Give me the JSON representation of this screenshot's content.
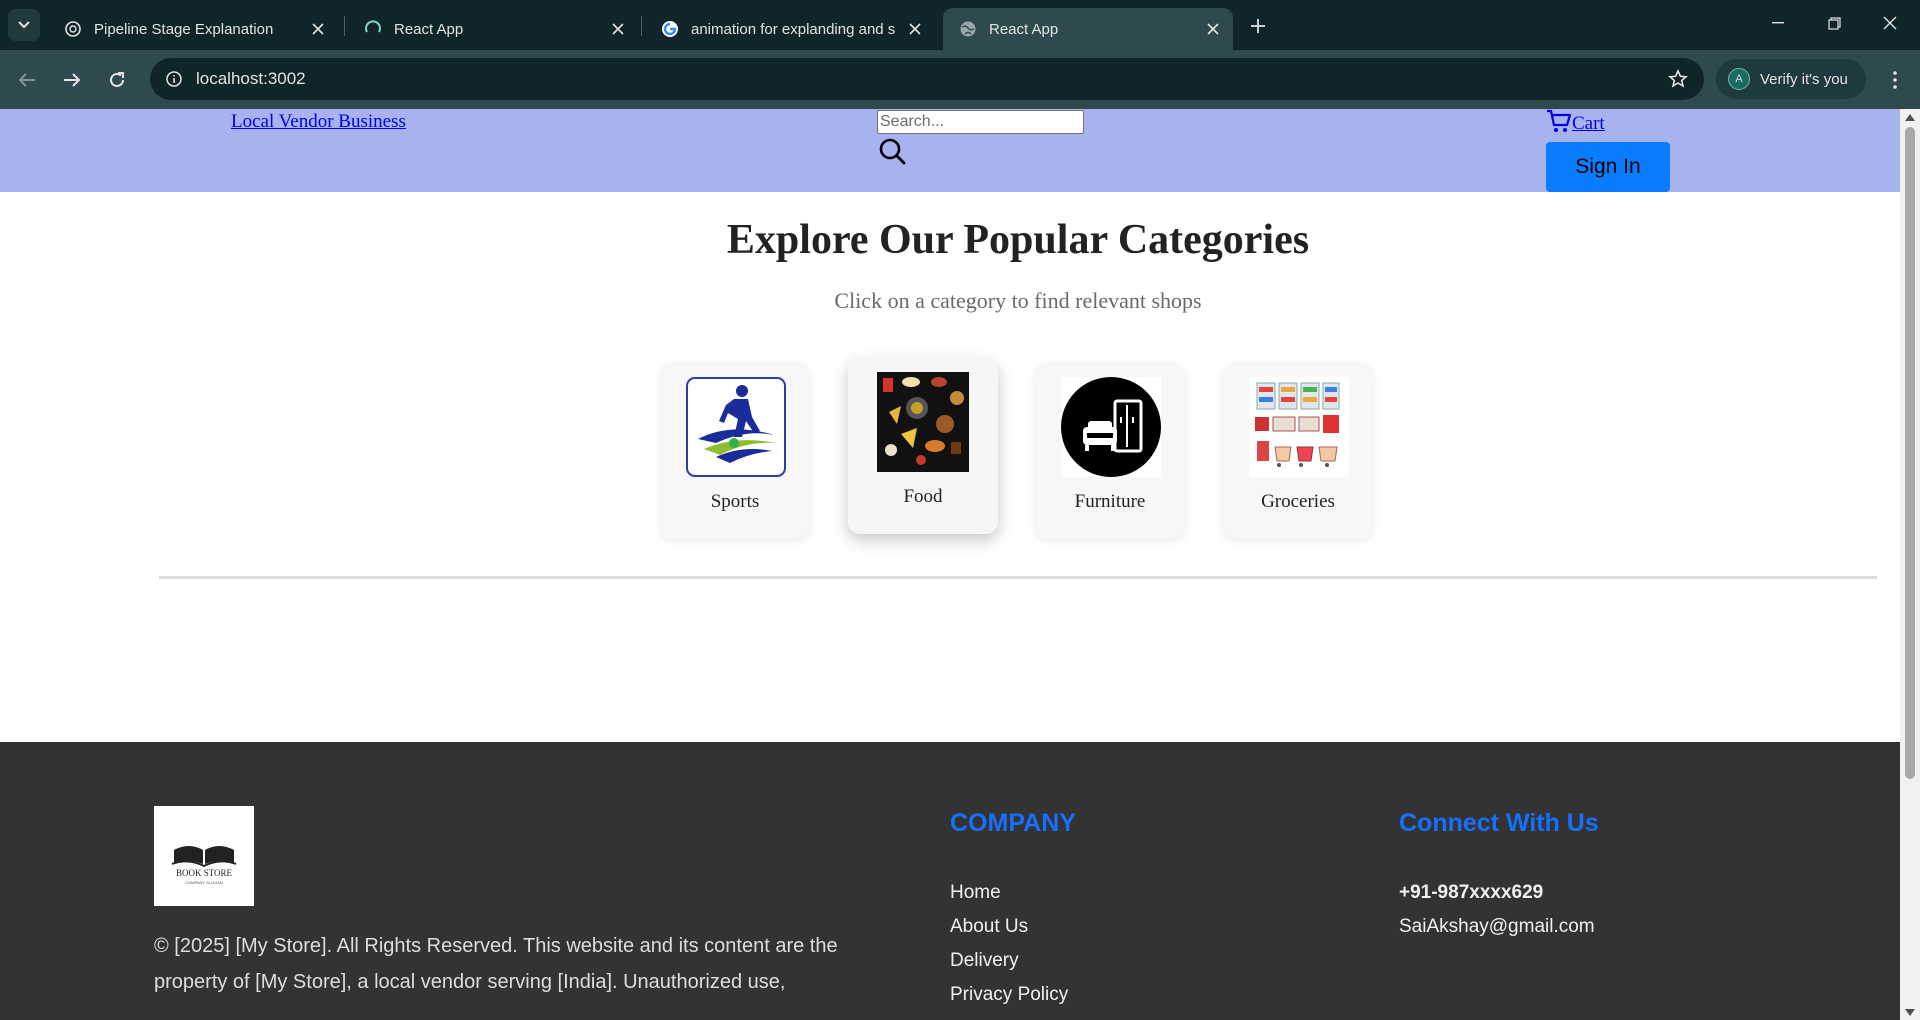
{
  "browser": {
    "tabs": [
      {
        "title": "Pipeline Stage Explanation",
        "icon": "openai-icon",
        "active": false
      },
      {
        "title": "React App",
        "icon": "loading-spinner-icon",
        "active": false
      },
      {
        "title": "animation for explanding and sh",
        "icon": "google-icon",
        "active": false
      },
      {
        "title": "React App",
        "icon": "globe-icon",
        "active": true
      }
    ],
    "url": "localhost:3002",
    "profile_label": "Verify it's you",
    "profile_initial": "A"
  },
  "header": {
    "brand": "Local Vendor Business",
    "search_placeholder": "Search...",
    "cart_label": "Cart",
    "signin_label": "Sign In",
    "bg_color": "#a8b2ef",
    "signin_color": "#0a7cff"
  },
  "categories": {
    "title": "Explore Our Popular Categories",
    "subtitle": "Click on a category to find relevant shops",
    "items": [
      {
        "label": "Sports",
        "icon": "sports-player-icon"
      },
      {
        "label": "Food",
        "icon": "food-collage-icon"
      },
      {
        "label": "Furniture",
        "icon": "furniture-icon"
      },
      {
        "label": "Groceries",
        "icon": "groceries-shelves-icon"
      }
    ]
  },
  "footer": {
    "logo_text": "BOOK STORE",
    "logo_subtext": "COMPANY SLOGAN",
    "copyright_line1": "© [2025] [My Store]. All Rights Reserved. This website and its content are the",
    "copyright_line2": "property of [My Store], a local vendor serving [India]. Unauthorized use,",
    "company_heading": "COMPANY",
    "company_links": [
      "Home",
      "About Us",
      "Delivery",
      "Privacy Policy"
    ],
    "connect_heading": "Connect With Us",
    "phone": "+91-987xxxx629",
    "email": "SaiAkshay@gmail.com",
    "heading_color": "#1570ff"
  }
}
